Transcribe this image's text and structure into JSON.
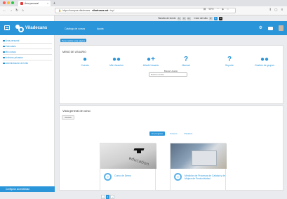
{
  "browser": {
    "tab_title": "Área personal",
    "url_prefix": "https://campus.viladecans.",
    "url_domain": "viladecans.cat",
    "url_suffix": "/my/",
    "zoom": "90%",
    "accent": "#2a95d9"
  },
  "site": {
    "brand": "Viladecans",
    "nav_links": [
      "Catálogo de cursos",
      "Ayuda"
    ],
    "accessibility_label": "Tamaño de fuente",
    "contrast_label": "Color del sitio",
    "font_buttons": [
      "A-",
      "A",
      "A+"
    ],
    "color_buttons": [
      "R",
      "A",
      "N"
    ]
  },
  "sidebar": {
    "items": [
      {
        "label": "Área personal"
      },
      {
        "label": "Calendario"
      },
      {
        "label": "Mis cursos"
      },
      {
        "label": "Archivos privados"
      },
      {
        "label": "Administración del sitio"
      }
    ],
    "footer": "Configurar accesibilidad"
  },
  "page_button": "Personalizar esta página",
  "user_menu": {
    "title": "MENÚ DE USUARIO",
    "items": [
      {
        "label": "Cuenta",
        "icon": "user-icon"
      },
      {
        "label": "Mis Usuarios",
        "icon": "users-icon"
      },
      {
        "label": "Añadir Usuario",
        "icon": "add-user-icon"
      },
      {
        "label": "Manual",
        "icon": "question-icon"
      },
      {
        "label": "Soporte",
        "icon": "question-icon"
      },
      {
        "label": "Gestión de grupos",
        "icon": "group-icon"
      }
    ],
    "search_label": "Buscar Usuario",
    "search_placeholder": "Buscar nombre"
  },
  "overview": {
    "title": "Vista general de curso",
    "filter_button": "Cursos",
    "tabs": [
      "En progreso",
      "Futuros",
      "Pasados"
    ],
    "courses": [
      {
        "name": "Curso de Demo"
      },
      {
        "name": "Medición de Procesos de Calidad y de Mejora de Productividad"
      }
    ],
    "image_text": "education",
    "pager": [
      "«",
      "1",
      "»"
    ]
  }
}
